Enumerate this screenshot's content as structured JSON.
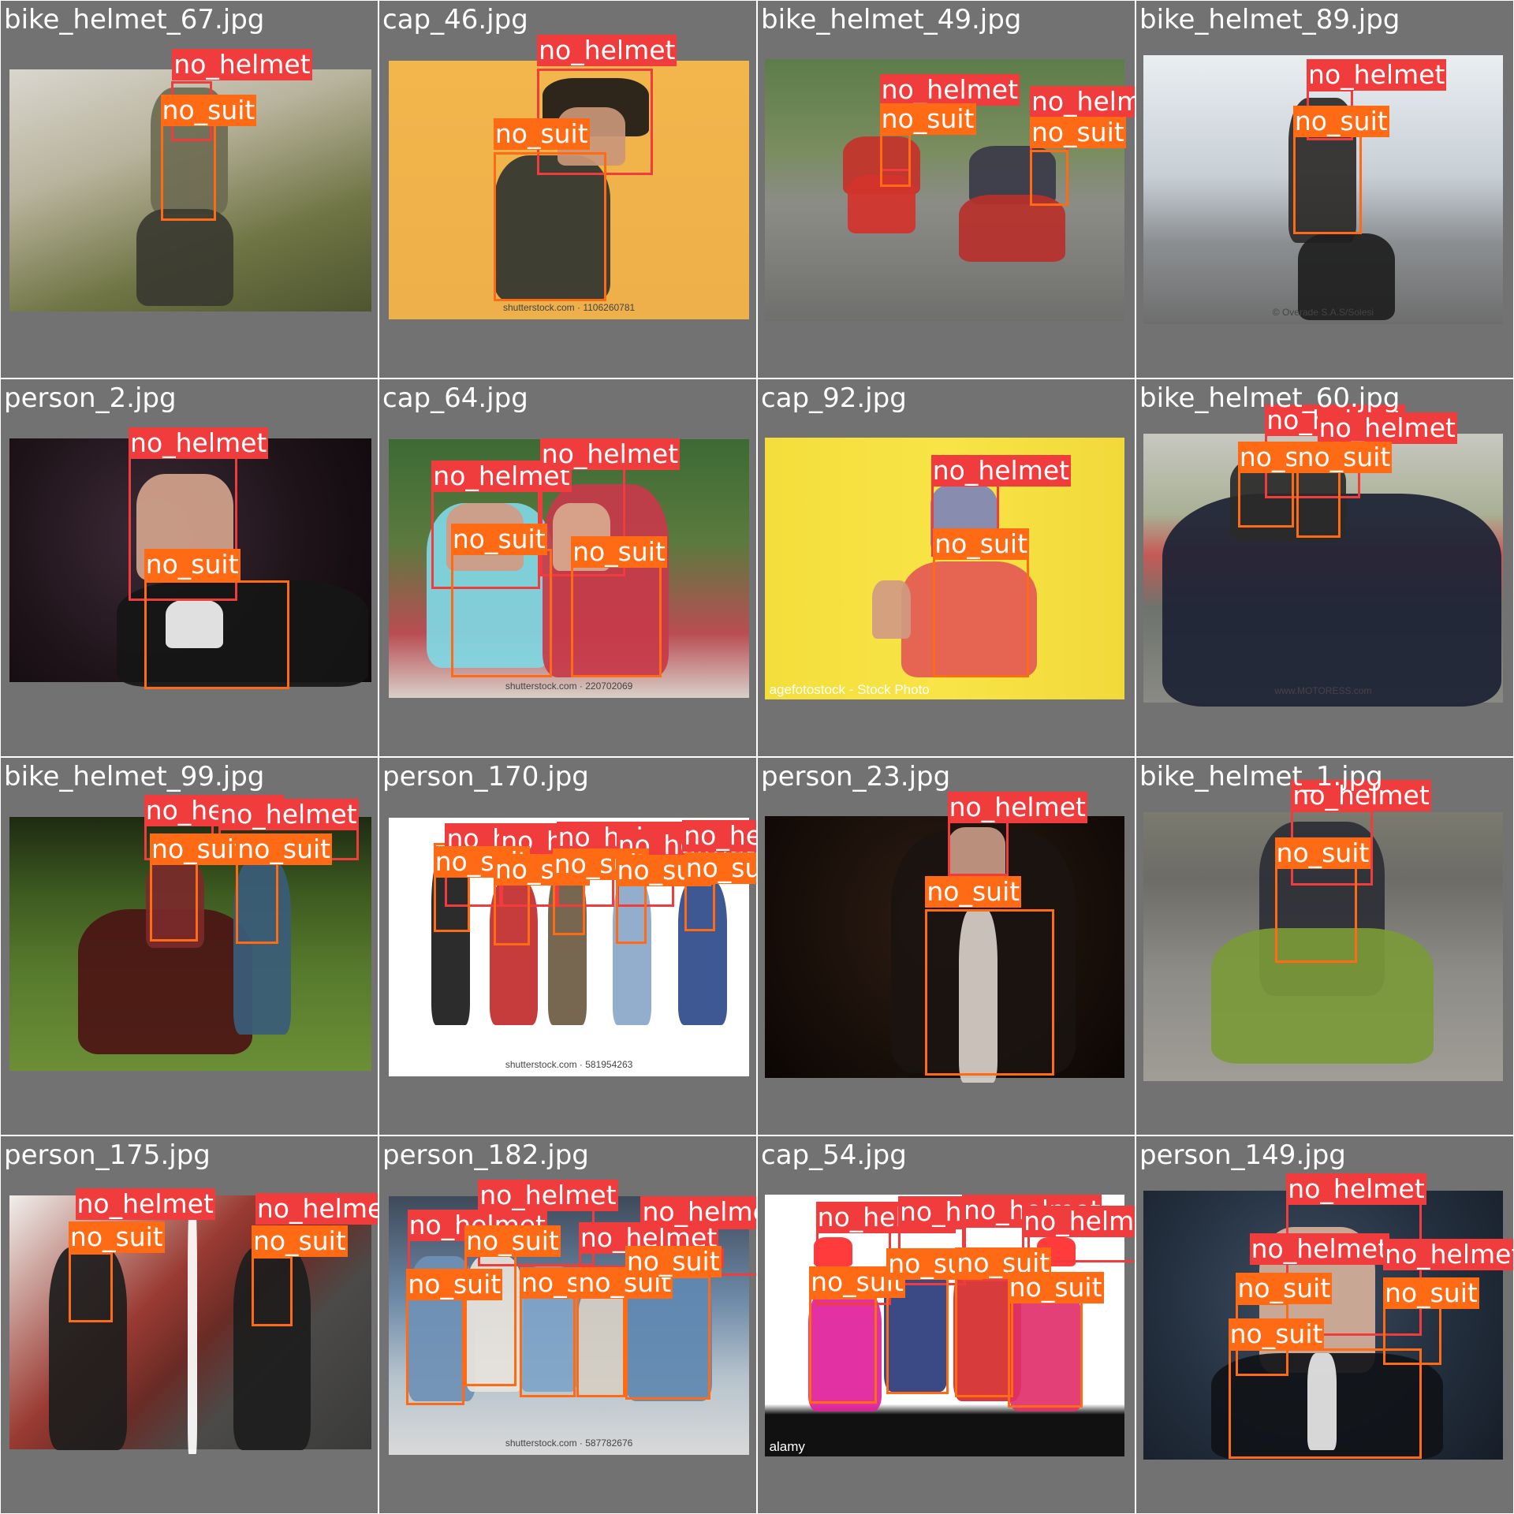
{
  "classes": {
    "no_helmet": {
      "label": "no_helmet",
      "color": "#f03c3c"
    },
    "no_suit": {
      "label": "no_suit",
      "color": "#ff6a14"
    }
  },
  "tiles": [
    {
      "file": "bike_helmet_67.jpg",
      "scene": "cyclist on a hillside trail",
      "watermark": ""
    },
    {
      "file": "cap_46.jpg",
      "scene": "man in hat on yellow background",
      "watermark": "shutterstock.com · 1106260781"
    },
    {
      "file": "bike_helmet_49.jpg",
      "scene": "two riders on red scooters",
      "watermark": ""
    },
    {
      "file": "bike_helmet_89.jpg",
      "scene": "woman on a bike in a city street",
      "watermark": "© Overade S.A.S/Solesi"
    },
    {
      "file": "person_2.jpg",
      "scene": "man in a tuxedo",
      "watermark": ""
    },
    {
      "file": "cap_64.jpg",
      "scene": "two young women with caps",
      "watermark": "shutterstock.com · 220702069"
    },
    {
      "file": "cap_92.jpg",
      "scene": "man in bucket hat on yellow wall",
      "watermark": "agefotostock - Stock Photo"
    },
    {
      "file": "bike_helmet_60.jpg",
      "scene": "riders on a large touring motorbike",
      "watermark": "www.MOTORESS.com"
    },
    {
      "file": "bike_helmet_99.jpg",
      "scene": "people with a motorbike on grass",
      "watermark": ""
    },
    {
      "file": "person_170.jpg",
      "scene": "group of five people standing",
      "watermark": "shutterstock.com · 581954263"
    },
    {
      "file": "person_23.jpg",
      "scene": "man speaking with a microphone",
      "watermark": ""
    },
    {
      "file": "bike_helmet_1.jpg",
      "scene": "rider on a small motorbike",
      "watermark": ""
    },
    {
      "file": "person_175.jpg",
      "scene": "woman on stairs, two frames",
      "watermark": ""
    },
    {
      "file": "person_182.jpg",
      "scene": "group of friends in denim",
      "watermark": "shutterstock.com · 587782676"
    },
    {
      "file": "cap_54.jpg",
      "scene": "group in christmas hats",
      "watermark": "alamy"
    },
    {
      "file": "person_149.jpg",
      "scene": "man in suit, dark backdrop",
      "watermark": ""
    }
  ]
}
